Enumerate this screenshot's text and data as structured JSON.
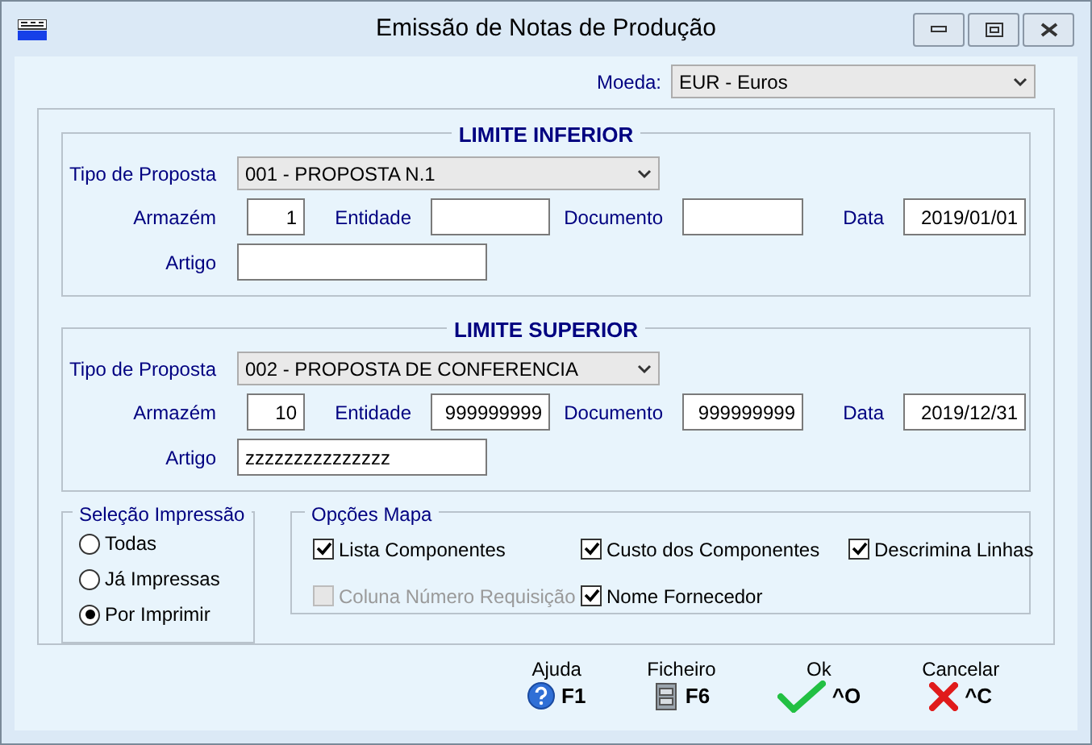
{
  "window": {
    "title": "Emissão de Notas de Produção"
  },
  "currency": {
    "label": "Moeda:",
    "value": "EUR - Euros"
  },
  "limits": [
    {
      "title": "LIMITE INFERIOR",
      "proposal": {
        "label": "Tipo de Proposta",
        "value": "001 - PROPOSTA N.1"
      },
      "fields": [
        {
          "label": "Armazém",
          "value": "1"
        },
        {
          "label": "Entidade"
        },
        {
          "label": "Documento"
        },
        {
          "label": "Data",
          "value": "2019/01/01"
        }
      ],
      "article": {
        "label": "Artigo"
      }
    },
    {
      "title": "LIMITE SUPERIOR",
      "proposal": {
        "label": "Tipo de Proposta",
        "value": "002 - PROPOSTA DE CONFERENCIA"
      },
      "fields": [
        {
          "label": "Armazém",
          "value": "10"
        },
        {
          "label": "Entidade",
          "value": "999999999"
        },
        {
          "label": "Documento",
          "value": "999999999"
        },
        {
          "label": "Data",
          "value": "2019/12/31"
        }
      ],
      "article": {
        "label": "Artigo",
        "value": "zzzzzzzzzzzzzzz"
      }
    }
  ],
  "print_selection": {
    "title": "Seleção Impressão",
    "options": [
      {
        "label": "Todas",
        "selected": false
      },
      {
        "label": "Já Impressas",
        "selected": false
      },
      {
        "label": "Por Imprimir",
        "selected": true
      }
    ]
  },
  "map_options": {
    "title": "Opções Mapa",
    "options": [
      {
        "label": "Lista Componentes",
        "checked": true,
        "disabled": false
      },
      {
        "label": "Custo dos Componentes",
        "checked": true,
        "disabled": false
      },
      {
        "label": "Descrimina Linhas",
        "checked": true,
        "disabled": false
      },
      {
        "label": "Coluna Número Requisição",
        "checked": false,
        "disabled": true
      },
      {
        "label": "Nome Fornecedor",
        "checked": true,
        "disabled": false
      }
    ]
  },
  "actions": [
    {
      "kind": "help",
      "label": "Ajuda",
      "key": "F1"
    },
    {
      "kind": "file",
      "label": "Ficheiro",
      "key": "F6"
    },
    {
      "kind": "ok",
      "label": "Ok",
      "key": "^O"
    },
    {
      "kind": "cancel",
      "label": "Cancelar",
      "key": "^C"
    }
  ]
}
